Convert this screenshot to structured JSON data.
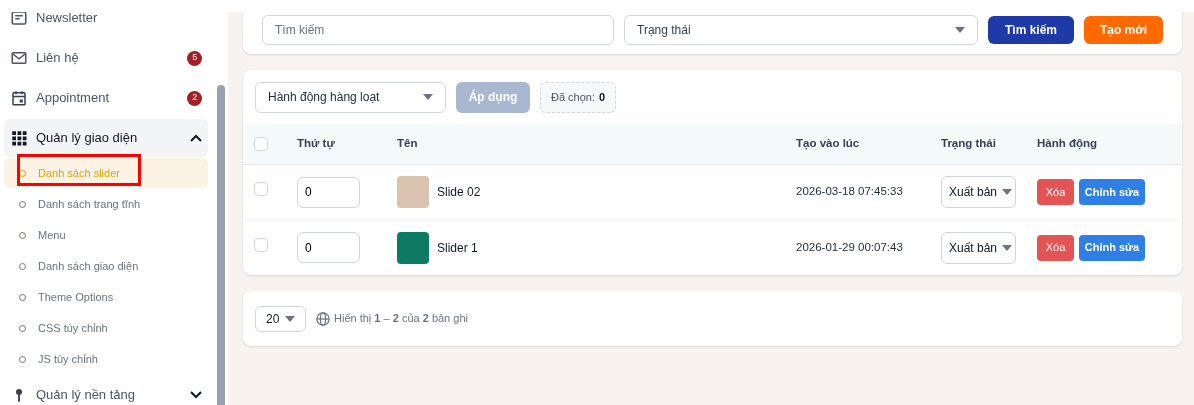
{
  "sidebar": {
    "items": [
      {
        "kind": "link",
        "label": "Newsletter"
      },
      {
        "kind": "link",
        "label": "Liên hệ",
        "badge": "5"
      },
      {
        "kind": "link",
        "label": "Appointment",
        "badge": "2"
      },
      {
        "kind": "group",
        "label": "Quản lý giao diện",
        "expanded": true,
        "children": [
          {
            "label": "Danh sách slider",
            "selected": true,
            "annotated": true
          },
          {
            "label": "Danh sách trang tĩnh",
            "selected": false,
            "annotated": false
          },
          {
            "label": "Menu",
            "selected": false,
            "annotated": false
          },
          {
            "label": "Danh sách giao diện",
            "selected": false,
            "annotated": false
          },
          {
            "label": "Theme Options",
            "selected": false,
            "annotated": false
          },
          {
            "label": "CSS tùy chỉnh",
            "selected": false,
            "annotated": false
          },
          {
            "label": "JS tùy chỉnh",
            "selected": false,
            "annotated": false
          }
        ]
      },
      {
        "kind": "group",
        "label": "Quản lý nền tảng",
        "expanded": false
      }
    ]
  },
  "filters": {
    "search": {
      "placeholder": "Tìm kiếm"
    },
    "status": {
      "placeholder": "Trạng thái"
    },
    "buttons": [
      {
        "kind": "primary",
        "label": "Tìm kiếm"
      },
      {
        "kind": "create",
        "label": "Tạo mới"
      }
    ]
  },
  "bulk": {
    "action": {
      "placeholder": "Hành động hàng loạt"
    },
    "apply": {
      "label": "Áp dụng",
      "disabled": true
    },
    "selected_label": "Đã chọn:",
    "selected_count": "0"
  },
  "table": {
    "header_checked": false,
    "columns": [
      "Thứ tự",
      "Tên",
      "Tạo vào lúc",
      "Trạng thái",
      "Hành động"
    ],
    "rows": [
      {
        "checked": false,
        "order": "0",
        "name": "Slide 02",
        "created": "2026-03-18 07:45:33",
        "status": "Xuất bản",
        "actions": [
          {
            "kind": "delete",
            "label": "Xóa"
          },
          {
            "kind": "edit",
            "label": "Chỉnh sửa"
          }
        ]
      },
      {
        "checked": false,
        "order": "0",
        "name": "Slider 1",
        "created": "2026-01-29 00:07:43",
        "status": "Xuất bản",
        "actions": [
          {
            "kind": "delete",
            "label": "Xóa"
          },
          {
            "kind": "edit",
            "label": "Chỉnh sửa"
          }
        ]
      }
    ]
  },
  "pagination": {
    "per_page": "20",
    "summary": "Hiển thị **1** – **2** của **2** bản ghi"
  }
}
